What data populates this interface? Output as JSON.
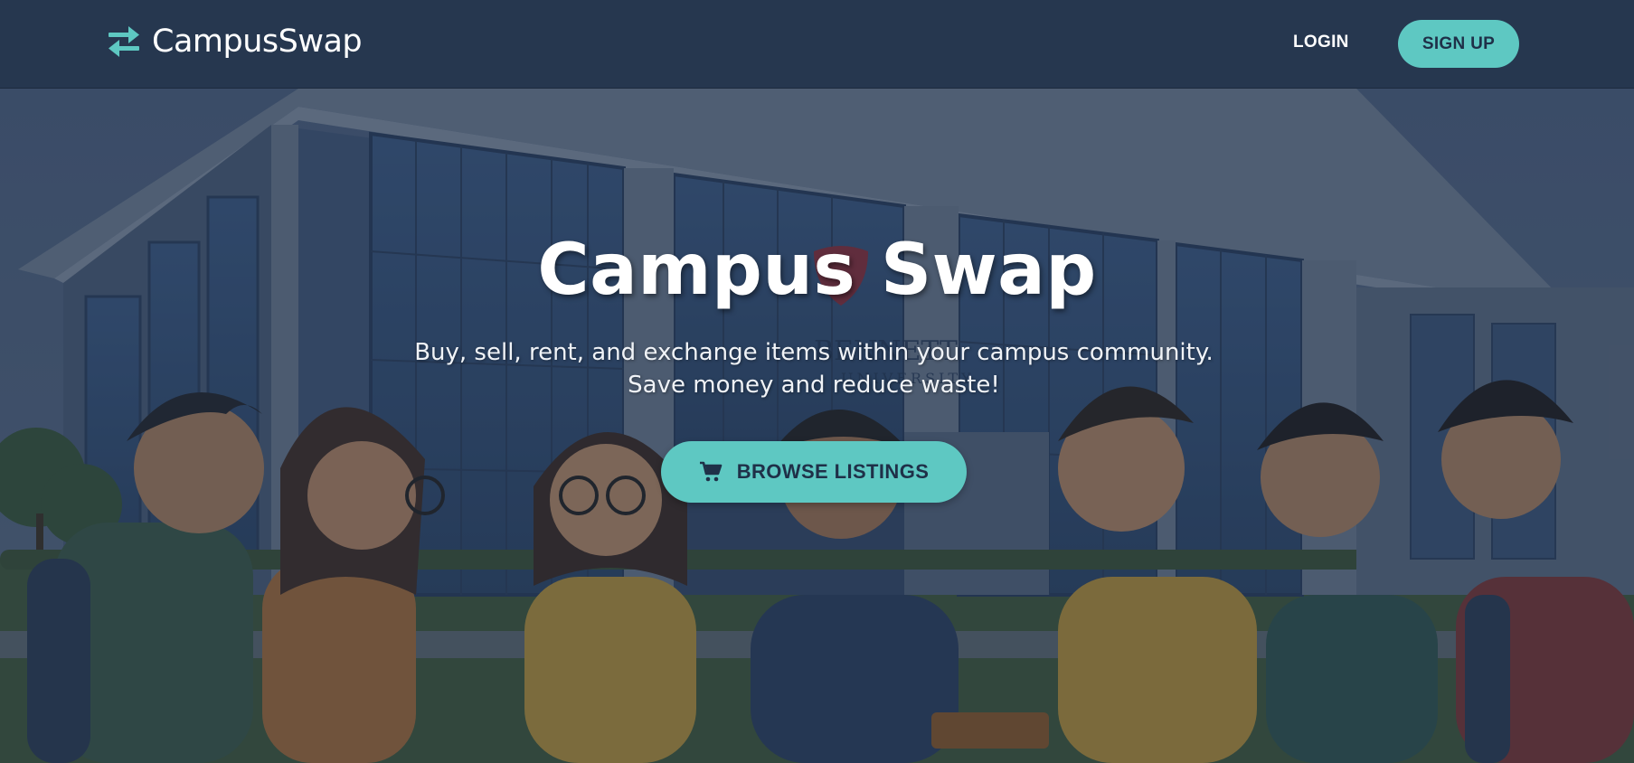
{
  "brand": {
    "name": "CampusSwap",
    "icon": "swap-arrows-icon",
    "accent": "#5ec8c2"
  },
  "nav": {
    "login_label": "LOGIN",
    "signup_label": "SIGN UP"
  },
  "hero": {
    "title": "Campus Swap",
    "subtitle": "Buy, sell, rent, and exchange items within your campus community. Save money and reduce waste!",
    "cta_label": "BROWSE LISTINGS",
    "cta_icon": "cart-icon",
    "background_sign": {
      "line1": "BENNETT",
      "line2": "UNIVERSITY"
    }
  },
  "colors": {
    "navbar": "#26374f",
    "accent": "#5ec8c2",
    "button_text": "#1f3048"
  }
}
